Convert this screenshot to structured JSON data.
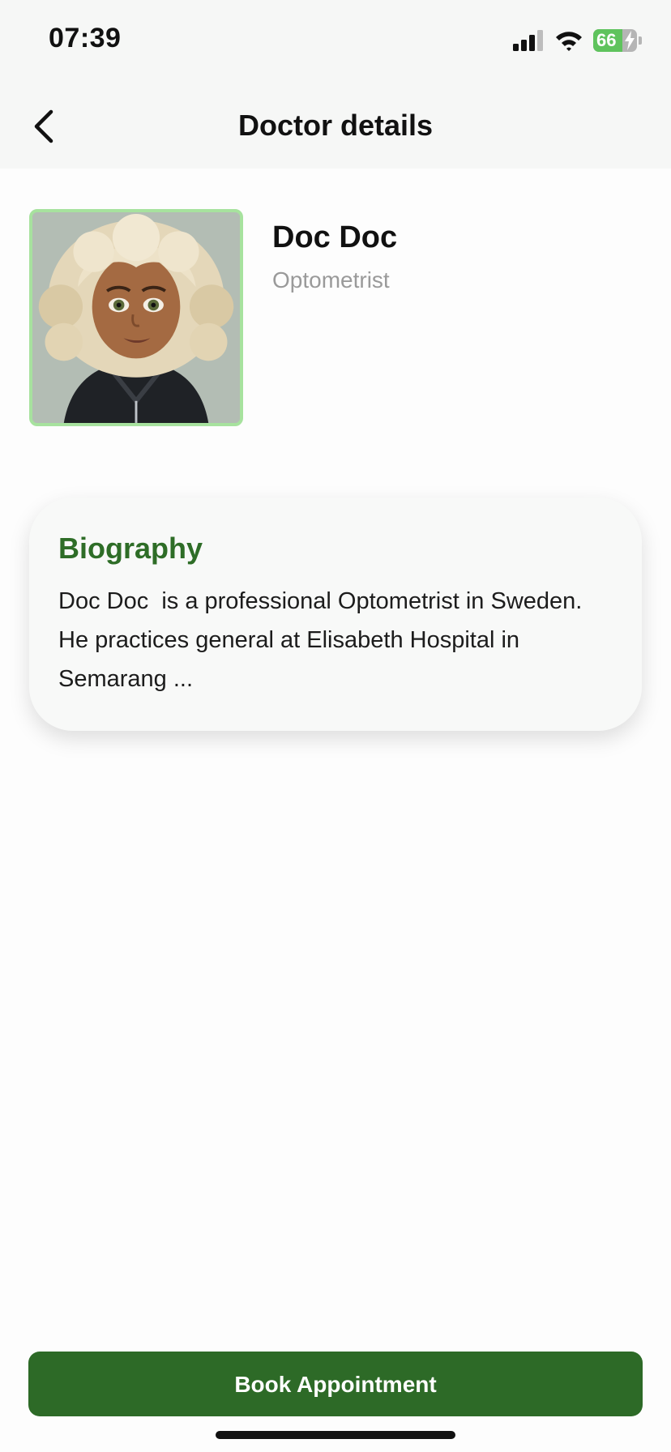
{
  "status_bar": {
    "time": "07:39",
    "battery_level": "66",
    "battery_fraction": 0.66,
    "icons": [
      "signal-icon",
      "wifi-icon",
      "battery-icon",
      "charging-bolt-icon"
    ]
  },
  "header": {
    "title": "Doctor details",
    "back_icon": "chevron-left-icon"
  },
  "doctor": {
    "name": "Doc Doc",
    "specialty": "Optometrist",
    "avatar_icon": "doctor-avatar"
  },
  "biography": {
    "title": "Biography",
    "text": "Doc Doc  is a professional Optometrist in Sweden. He practices general at Elisabeth Hospital in Semarang ..."
  },
  "actions": {
    "book_label": "Book Appointment"
  },
  "colors": {
    "accent": "#2d6a27",
    "bio_title": "#2e6d27",
    "avatar_border": "#a7e29e",
    "battery_fill": "#5fc35d"
  }
}
